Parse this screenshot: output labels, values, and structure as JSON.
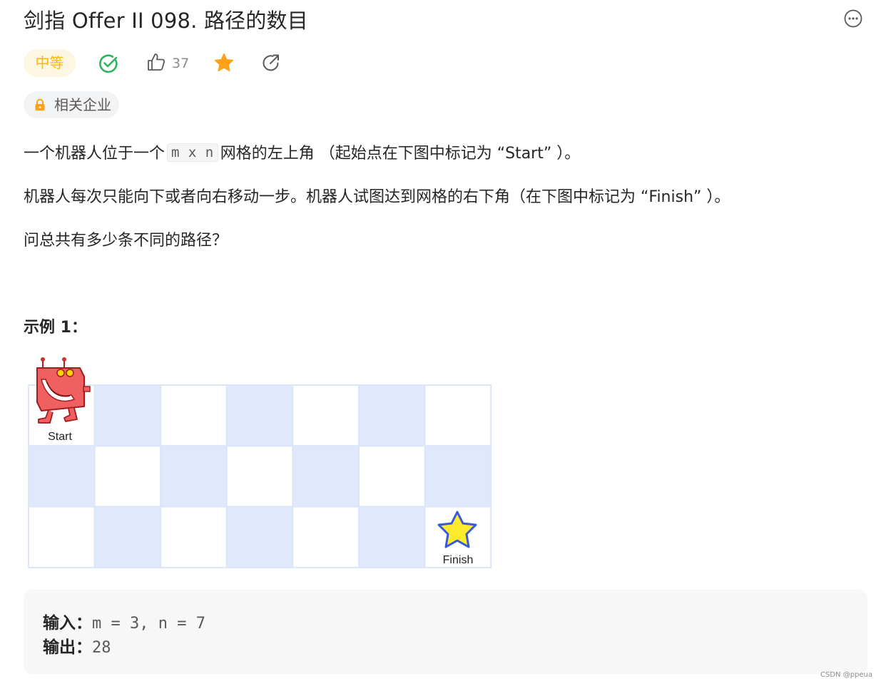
{
  "problem": {
    "title": "剑指 Offer II 098. 路径的数目",
    "difficulty": "中等",
    "likes": "37",
    "tag_label": "相关企业"
  },
  "description": {
    "p1_before": "一个机器人位于一个",
    "p1_code": "m x n",
    "p1_after": "网格的左上角 （起始点在下图中标记为 “Start” ）。",
    "p2": "机器人每次只能向下或者向右移动一步。机器人试图达到网格的右下角（在下图中标记为 “Finish” ）。",
    "p3": "问总共有多少条不同的路径？"
  },
  "example": {
    "title": "示例 1：",
    "start_label": "Start",
    "finish_label": "Finish",
    "grid": {
      "rows": 3,
      "cols": 7,
      "cell_colors": [
        "#ffffff",
        "#dfe9fb"
      ]
    },
    "input_label": "输入：",
    "input_value": "m = 3, n = 7",
    "output_label": "输出：",
    "output_value": "28"
  },
  "icons": {
    "more": "more-horizontal-icon",
    "solved": "check-circle-icon",
    "like": "thumbs-up-icon",
    "favorite": "star-icon",
    "share": "share-icon",
    "lock": "lock-icon"
  },
  "colors": {
    "difficulty_text": "#ffb800",
    "difficulty_bg": "#fdf6e3",
    "solved_green": "#2db55d",
    "star_orange": "#ffa116",
    "grid_blue": "#dfe9fb"
  },
  "watermark": "CSDN @ppeua"
}
